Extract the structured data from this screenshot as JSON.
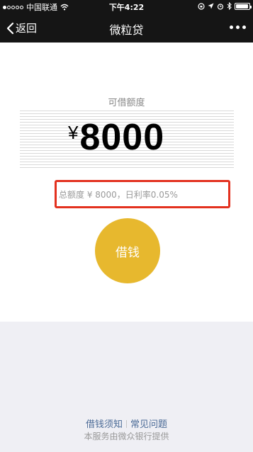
{
  "status_bar": {
    "carrier": "中国联通",
    "time": "下午4:22",
    "battery_level": 0.95
  },
  "nav": {
    "back_label": "返回",
    "title": "微粒贷"
  },
  "loan": {
    "limit_label": "可借额度",
    "currency_symbol": "¥",
    "amount": "8000",
    "info": "总额度 ¥ 8000，日利率0.05%",
    "borrow_button": "借钱"
  },
  "footer": {
    "link_notice": "借钱须知",
    "link_faq": "常见问题",
    "provider": "本服务由微众银行提供"
  },
  "colors": {
    "bar_bg": "#151515",
    "button_yellow": "#e7b82e",
    "highlight_red": "#e3311f",
    "link_blue": "#4a6a96",
    "footer_bg": "#efeff4"
  }
}
